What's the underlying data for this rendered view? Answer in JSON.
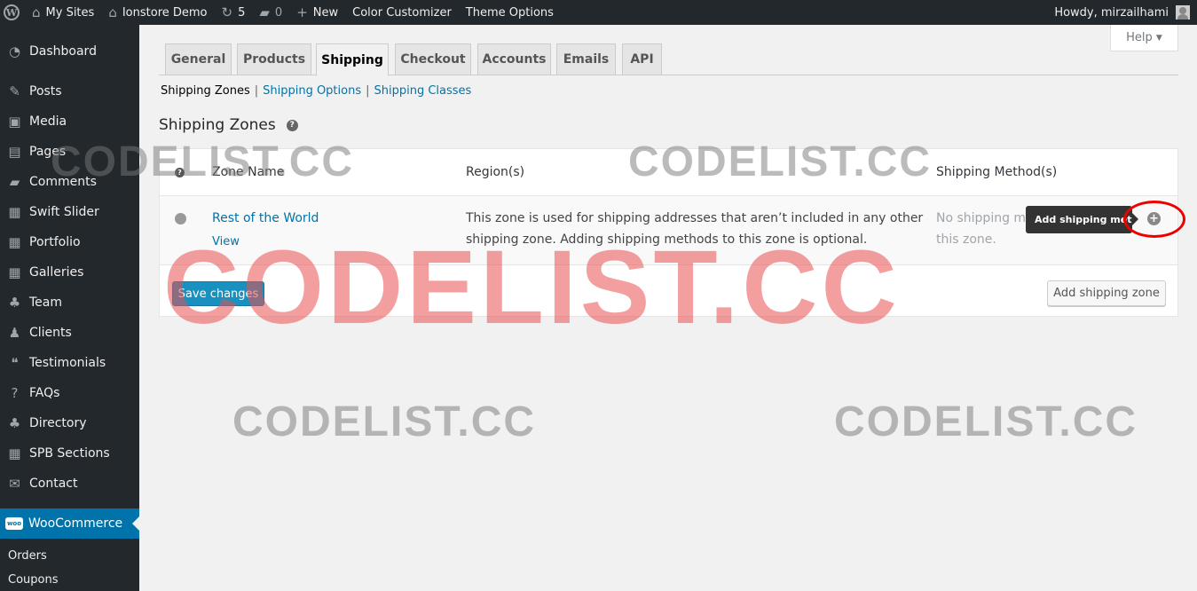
{
  "adminbar": {
    "my_sites": "My Sites",
    "site_name": "Ionstore Demo",
    "updates": "5",
    "comments": "0",
    "new": "New",
    "color_customizer": "Color Customizer",
    "theme_options": "Theme Options",
    "howdy": "Howdy, mirzailhami"
  },
  "sidebar": {
    "items": [
      {
        "label": "Dashboard",
        "icon": "dashboard-icon"
      },
      {
        "label": "Posts",
        "icon": "pin-icon"
      },
      {
        "label": "Media",
        "icon": "media-icon"
      },
      {
        "label": "Pages",
        "icon": "pages-icon"
      },
      {
        "label": "Comments",
        "icon": "comment-icon"
      },
      {
        "label": "Swift Slider",
        "icon": "slider-icon"
      },
      {
        "label": "Portfolio",
        "icon": "portfolio-icon"
      },
      {
        "label": "Galleries",
        "icon": "gallery-icon"
      },
      {
        "label": "Team",
        "icon": "team-icon"
      },
      {
        "label": "Clients",
        "icon": "clients-icon"
      },
      {
        "label": "Testimonials",
        "icon": "quote-icon"
      },
      {
        "label": "FAQs",
        "icon": "help-icon"
      },
      {
        "label": "Directory",
        "icon": "directory-icon"
      },
      {
        "label": "SPB Sections",
        "icon": "grid-icon"
      },
      {
        "label": "Contact",
        "icon": "mail-icon"
      }
    ],
    "woocommerce": "WooCommerce",
    "woo_badge": "woo",
    "subitems": [
      "Orders",
      "Coupons"
    ]
  },
  "help": {
    "label": "Help",
    "arrow": "▼"
  },
  "tabs": [
    "General",
    "Products",
    "Shipping",
    "Checkout",
    "Accounts",
    "Emails",
    "API"
  ],
  "subsub": {
    "current": "Shipping Zones",
    "options": "Shipping Options",
    "classes": "Shipping Classes",
    "separator": "|"
  },
  "zones": {
    "title": "Shipping Zones",
    "help_mark": "?",
    "columns": {
      "name": "Zone Name",
      "region": "Region(s)",
      "methods": "Shipping Method(s)"
    },
    "row": {
      "name": "Rest of the World",
      "view": "View",
      "region_line1": "This zone is used for shipping addresses that aren’t included in any other",
      "region_line2": "shipping zone. Adding shipping methods to this zone is optional.",
      "methods_line1": "No shipping me",
      "methods_line2": "this zone."
    },
    "tooltip": "Add shipping method",
    "add_icon": "+",
    "save_button": "Save changes",
    "add_zone_button": "Add shipping zone"
  },
  "watermark": "CODELIST.CC"
}
